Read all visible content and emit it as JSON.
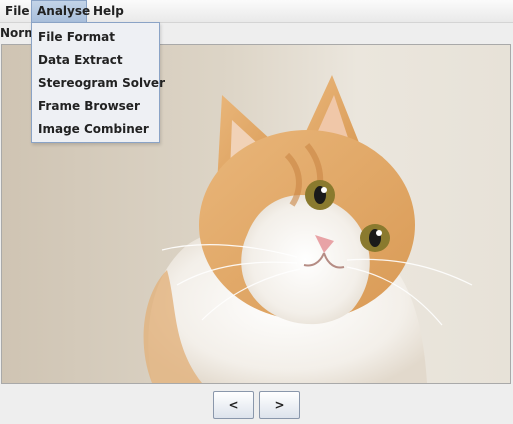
{
  "menubar": {
    "items": [
      {
        "label": "File"
      },
      {
        "label": "Analyse"
      },
      {
        "label": "Help"
      }
    ]
  },
  "mode_label": "Normal",
  "analyse_menu": {
    "items": [
      {
        "label": "File Format"
      },
      {
        "label": "Data Extract"
      },
      {
        "label": "Stereogram Solver"
      },
      {
        "label": "Frame Browser"
      },
      {
        "label": "Image Combiner"
      }
    ]
  },
  "nav": {
    "prev_label": "<",
    "next_label": ">"
  },
  "colors": {
    "menu_highlight": "#b3c7e0",
    "dropdown_bg": "#eef0f4",
    "window_bg": "#eeeeee"
  }
}
